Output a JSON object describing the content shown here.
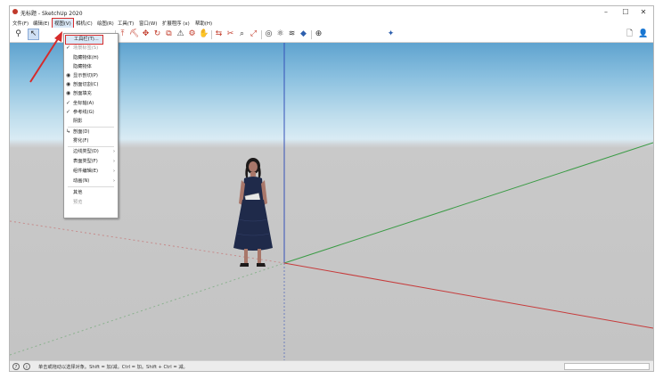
{
  "window": {
    "title": "无标题 - SketchUp 2020",
    "controls": {
      "minimize": "–",
      "maximize": "☐",
      "close": "✕"
    }
  },
  "menubar": {
    "items": [
      {
        "label": "文件(F)"
      },
      {
        "label": "编辑(E)"
      },
      {
        "label": "视图(V)"
      },
      {
        "label": "相机(C)"
      },
      {
        "label": "绘图(R)"
      },
      {
        "label": "工具(T)"
      },
      {
        "label": "窗口(W)"
      },
      {
        "label": "扩展程序 (x)"
      },
      {
        "label": "帮助(H)"
      }
    ]
  },
  "view_menu": {
    "items": [
      {
        "label": "工具栏(T)...",
        "check": "",
        "submenu": false,
        "disabled": false,
        "highlighted": true
      },
      {
        "label": "场景标签(S)",
        "check": "✓",
        "submenu": false,
        "disabled": true,
        "highlighted": false
      },
      {
        "label": "隐藏物体(H)",
        "check": "",
        "submenu": false,
        "disabled": false,
        "highlighted": false
      },
      {
        "label": "隐藏物体",
        "check": "",
        "submenu": false,
        "disabled": false,
        "highlighted": false
      },
      {
        "label": "显示剖切(P)",
        "check": "◉",
        "submenu": false,
        "disabled": false,
        "highlighted": false
      },
      {
        "label": "剖面切割(C)",
        "check": "◉",
        "submenu": false,
        "disabled": false,
        "highlighted": false
      },
      {
        "label": "剖面填充",
        "check": "◉",
        "submenu": false,
        "disabled": false,
        "highlighted": false
      },
      {
        "label": "坐标轴(A)",
        "check": "✓",
        "submenu": false,
        "disabled": false,
        "highlighted": false
      },
      {
        "label": "参考线(G)",
        "check": "✓",
        "submenu": false,
        "disabled": false,
        "highlighted": false
      },
      {
        "label": "阴影",
        "check": "",
        "submenu": false,
        "disabled": false,
        "highlighted": false
      },
      {
        "label": "雾化(F)",
        "check": "",
        "submenu": false,
        "disabled": false,
        "highlighted": false
      },
      {
        "label": "剖面(D)",
        "check": "↳",
        "submenu": false,
        "disabled": false,
        "highlighted": false
      },
      {
        "label": "雾化(F)",
        "check": "",
        "submenu": false,
        "disabled": false,
        "highlighted": false
      },
      {
        "label": "边线类型(D)",
        "check": "",
        "submenu": true,
        "disabled": false,
        "highlighted": false
      },
      {
        "label": "表面类型(F)",
        "check": "",
        "submenu": true,
        "disabled": false,
        "highlighted": false
      },
      {
        "label": "组件编辑(E)",
        "check": "",
        "submenu": true,
        "disabled": false,
        "highlighted": false
      },
      {
        "label": "动画(N)",
        "check": "",
        "submenu": true,
        "disabled": false,
        "highlighted": false
      },
      {
        "label": "其他",
        "check": "",
        "submenu": false,
        "disabled": false,
        "highlighted": false
      },
      {
        "label": "预览",
        "check": "",
        "submenu": false,
        "disabled": true,
        "highlighted": false
      }
    ]
  },
  "toolbar": {
    "icons": [
      {
        "name": "search-icon",
        "glyph": "⚲"
      },
      {
        "name": "select-arrow-icon",
        "glyph": "↖"
      },
      {
        "name": "push-pull-icon",
        "glyph": "⤒"
      },
      {
        "name": "paint-bucket-icon",
        "glyph": "⛏"
      },
      {
        "name": "move-icon",
        "glyph": "✥"
      },
      {
        "name": "rotate-icon",
        "glyph": "↻"
      },
      {
        "name": "scale-icon",
        "glyph": "⧉"
      },
      {
        "name": "warning-icon",
        "glyph": "⚠"
      },
      {
        "name": "orbit-icon",
        "glyph": "⚙"
      },
      {
        "name": "pan-icon",
        "glyph": "✋"
      },
      {
        "name": "section-icon",
        "glyph": "⇆"
      },
      {
        "name": "tape-icon",
        "glyph": "✂"
      },
      {
        "name": "zoom-icon",
        "glyph": "⌕"
      },
      {
        "name": "zoom-extents-icon",
        "glyph": "⤢"
      },
      {
        "name": "warehouse-icon",
        "glyph": "◎"
      },
      {
        "name": "extension-icon",
        "glyph": "⚛"
      },
      {
        "name": "layers-icon",
        "glyph": "≋"
      },
      {
        "name": "components-icon",
        "glyph": "◆"
      },
      {
        "name": "settings-icon",
        "glyph": "⊕"
      },
      {
        "name": "sparkle-icon",
        "glyph": "✦"
      },
      {
        "name": "new-document-icon",
        "glyph": "🗋"
      },
      {
        "name": "user-icon",
        "glyph": "👤"
      }
    ]
  },
  "statusbar": {
    "hint": "单击或拖动以选择对象。Shift = 加/减。Ctrl = 加。Shift + Ctrl = 减。",
    "icons": {
      "help": "?",
      "info": "i"
    }
  },
  "colors": {
    "accent_red": "#d62b2b",
    "axis_red": "#c63b3b",
    "axis_green": "#3a9b45",
    "axis_blue": "#3551b8",
    "ground": "#c4c4c4"
  }
}
